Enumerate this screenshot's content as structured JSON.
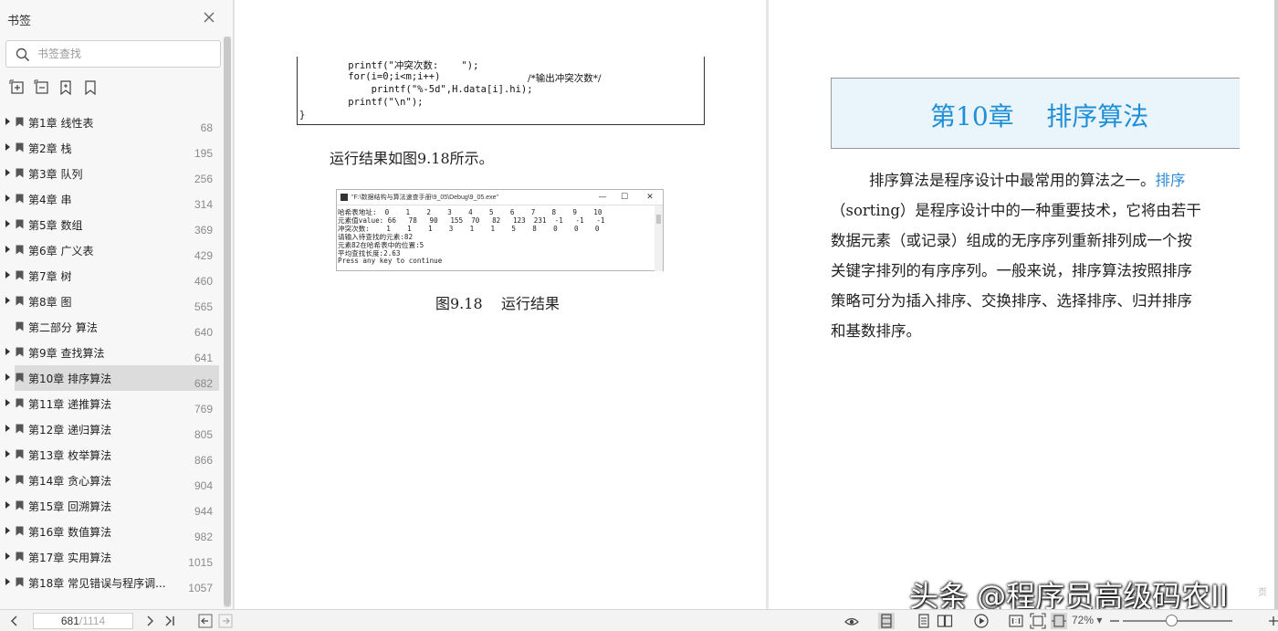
{
  "sidebar": {
    "title": "书签",
    "search_placeholder": "书签查找",
    "items": [
      {
        "label": "第1章 线性表",
        "page": "68"
      },
      {
        "label": "第2章 栈",
        "page": "195"
      },
      {
        "label": "第3章 队列",
        "page": "256"
      },
      {
        "label": "第4章 串",
        "page": "314"
      },
      {
        "label": "第5章 数组",
        "page": "369"
      },
      {
        "label": "第6章 广义表",
        "page": "429"
      },
      {
        "label": "第7章 树",
        "page": "460"
      },
      {
        "label": "第8章 图",
        "page": "565"
      },
      {
        "label": "第二部分 算法",
        "page": "640"
      },
      {
        "label": "第9章 查找算法",
        "page": "641"
      },
      {
        "label": "第10章 排序算法",
        "page": "682"
      },
      {
        "label": "第11章 递推算法",
        "page": "769"
      },
      {
        "label": "第12章 递归算法",
        "page": "805"
      },
      {
        "label": "第13章 枚举算法",
        "page": "866"
      },
      {
        "label": "第14章 贪心算法",
        "page": "904"
      },
      {
        "label": "第15章 回溯算法",
        "page": "944"
      },
      {
        "label": "第16章 数值算法",
        "page": "982"
      },
      {
        "label": "第17章 实用算法",
        "page": "1015"
      },
      {
        "label": "第18章 常见错误与程序调...",
        "page": "1057"
      }
    ],
    "active_index": 10
  },
  "left_page": {
    "code_lines": [
      "    printf(\"冲突次数:    \");",
      "    for(i=0;i<m;i++)",
      "        printf(\"%-5d\",H.data[i].hi);",
      "    printf(\"\\n\");",
      "}"
    ],
    "code_comment": "/*输出冲突次数*/",
    "run_text": "运行结果如图9.18所示。",
    "console": {
      "title": "\"F:\\数据结构与算法速查手册\\9_05\\Debug\\9_05.exe\"",
      "minimize": "—",
      "maximize": "☐",
      "close": "✕",
      "lines": [
        "哈希表地址:  0    1    2    3    4    5    6    7    8    9    10",
        "元素值value: 66   78   90   155  70   82   123  231  -1   -1   -1",
        "冲突次数:    1    1    1    3    1    1    5    8    0    0    0",
        "请输入待查找的元素:82",
        "元素82在哈希表中的位置:5",
        "平均查找长度:2.63",
        "Press any key to continue"
      ]
    },
    "figure_caption": "图9.18    运行结果"
  },
  "right_page": {
    "chapter_title": "第10章    排序算法",
    "paragraph_lines": [
      {
        "pre": "        排序算法是程序设计中最常用的算法之一。",
        "hl": "排序",
        "post": ""
      },
      {
        "pre": "（sorting）是程序设计中的一种重要技术，它将由若干",
        "hl": "",
        "post": ""
      },
      {
        "pre": "数据元素（或记录）组成的无序序列重新排列成一个按",
        "hl": "",
        "post": ""
      },
      {
        "pre": "关键字排列的有序序列。一般来说，排序算法按照排序",
        "hl": "",
        "post": ""
      },
      {
        "pre": "策略可分为插入排序、交换排序、选择排序、归并排序",
        "hl": "",
        "post": ""
      },
      {
        "pre": "和基数排序。",
        "hl": "",
        "post": ""
      }
    ]
  },
  "statusbar": {
    "page_current": "681",
    "page_total": "/1114",
    "zoom": "72%",
    "zoom_level_fraction": 0.44
  },
  "watermark": "头条 @程序员高级码农II",
  "watermark_tail": "页",
  "colors": {
    "accent": "#1f8fd8",
    "highlight_text": "#2f8dd6",
    "chapter_bg": "#e9f4fb",
    "active_item_bg": "#dcdcdc"
  }
}
